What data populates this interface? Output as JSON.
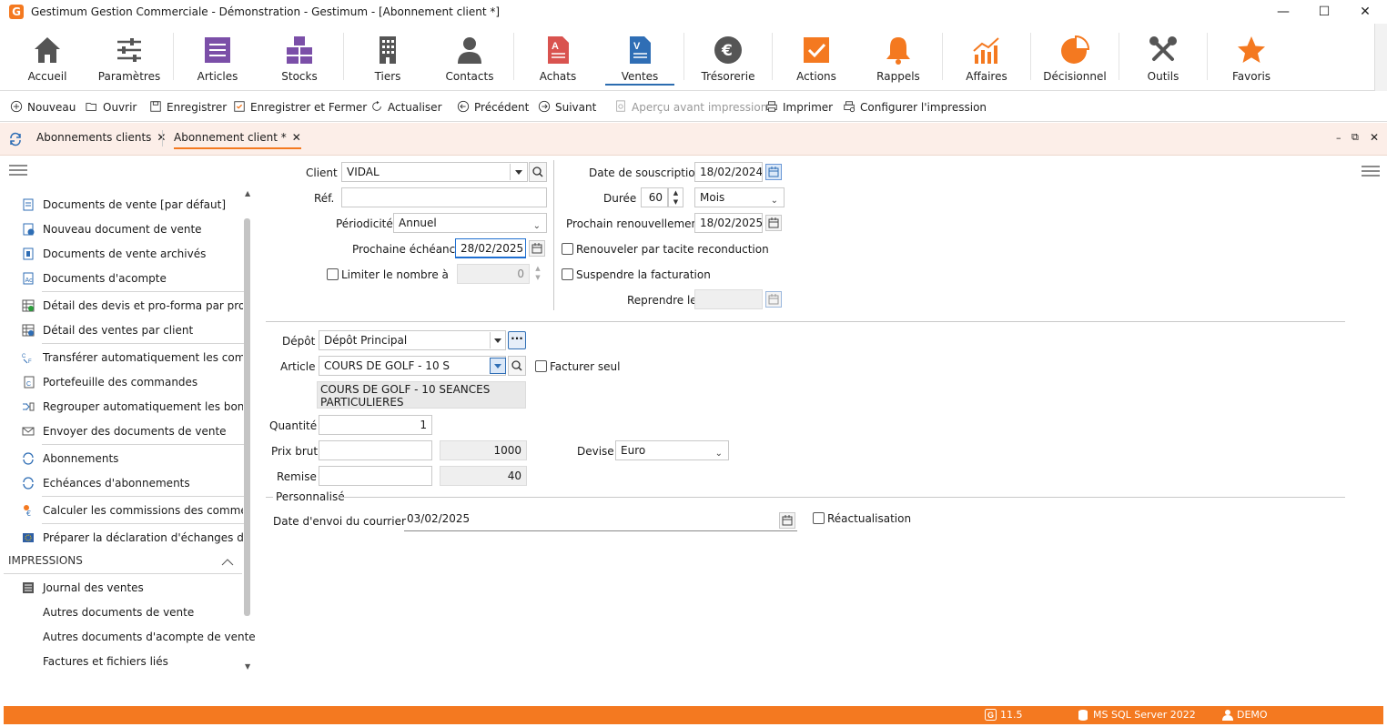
{
  "window": {
    "title": "Gestimum Gestion Commerciale - Démonstration - Gestimum - [Abonnement client *]",
    "logo": "G",
    "controls": {
      "minimize": "—",
      "maximize": "☐",
      "close": "✕"
    }
  },
  "ribbon": [
    {
      "label": "Accueil",
      "icon": "home-icon"
    },
    {
      "label": "Paramètres",
      "icon": "sliders-icon"
    },
    {
      "label": "Articles",
      "icon": "list-icon"
    },
    {
      "label": "Stocks",
      "icon": "boxes-icon"
    },
    {
      "label": "Tiers",
      "icon": "building-icon"
    },
    {
      "label": "Contacts",
      "icon": "person-icon"
    },
    {
      "label": "Achats",
      "icon": "document-icon"
    },
    {
      "label": "Ventes",
      "icon": "document-icon",
      "active": true
    },
    {
      "label": "Trésorerie",
      "icon": "euro-icon"
    },
    {
      "label": "Actions",
      "icon": "check-icon"
    },
    {
      "label": "Rappels",
      "icon": "bell-icon"
    },
    {
      "label": "Affaires",
      "icon": "chart-icon"
    },
    {
      "label": "Décisionnel",
      "icon": "pie-icon"
    },
    {
      "label": "Outils",
      "icon": "tools-icon"
    },
    {
      "label": "Favoris",
      "icon": "star-icon"
    }
  ],
  "toolbar": {
    "nouveau": "Nouveau",
    "ouvrir": "Ouvrir",
    "enregistrer": "Enregistrer",
    "enregistrer_fermer": "Enregistrer et Fermer",
    "actualiser": "Actualiser",
    "precedent": "Précédent",
    "suivant": "Suivant",
    "apercu": "Aperçu avant impression",
    "imprimer": "Imprimer",
    "configurer": "Configurer l'impression"
  },
  "tabs": {
    "tab1": "Abonnements clients",
    "tab2": "Abonnement client *",
    "close": "✕"
  },
  "sidebar": {
    "items": [
      "Documents de vente [par défaut]",
      "Nouveau document de vente",
      "Documents de vente archivés",
      "Documents d'acompte",
      "Détail des devis et pro-forma par prosp...",
      "Détail des ventes par client",
      "Transférer automatiquement les comm...",
      "Portefeuille des commandes",
      "Regrouper automatiquement les bons ...",
      "Envoyer des documents de vente",
      "Abonnements",
      "Echéances d'abonnements",
      "Calculer les commissions des commerc...",
      "Préparer la déclaration d'échanges de b..."
    ],
    "impressions_header": "IMPRESSIONS",
    "impressions": [
      "Journal des ventes",
      "Autres documents de vente",
      "Autres documents d'acompte de vente",
      "Factures et fichiers liés"
    ]
  },
  "form": {
    "client_label": "Client",
    "client_value": "VIDAL",
    "ref_label": "Réf.",
    "ref_value": "",
    "periodicite_label": "Périodicité",
    "periodicite_value": "Annuel",
    "prochaine_echeance_label": "Prochaine échéance",
    "prochaine_echeance_value": "28/02/2025",
    "limiter_label": "Limiter le nombre à",
    "limiter_value": "0",
    "date_souscription_label": "Date de souscription",
    "date_souscription_value": "18/02/2024",
    "duree_label": "Durée",
    "duree_value": "60",
    "duree_unit": "Mois",
    "prochain_renouvellement_label": "Prochain renouvellement",
    "prochain_renouvellement_value": "18/02/2025",
    "renouveler_label": "Renouveler par tacite reconduction",
    "suspendre_label": "Suspendre la facturation",
    "reprendre_label": "Reprendre le",
    "reprendre_value": "",
    "depot_label": "Dépôt",
    "depot_value": "Dépôt Principal",
    "depot_more": "···",
    "article_label": "Article",
    "article_value": "COURS DE GOLF - 10 S",
    "facturer_seul_label": "Facturer seul",
    "article_desc_line1": "COURS DE GOLF - 10 SEANCES",
    "article_desc_line2": "PARTICULIERES",
    "quantite_label": "Quantité",
    "quantite_value": "1",
    "prix_brut_label": "Prix brut",
    "prix_brut_value": "",
    "prix_brut_calc": "1000",
    "devise_label": "Devise",
    "devise_value": "Euro",
    "remise_label": "Remise",
    "remise_value": "",
    "remise_calc": "40",
    "personnalise_label": "Personnalisé",
    "date_envoi_label": "Date d'envoi du courrier",
    "date_envoi_value": "03/02/2025",
    "reactualisation_label": "Réactualisation"
  },
  "status": {
    "version": "11.5",
    "server": "MS SQL Server 2022",
    "user": "DEMO"
  }
}
